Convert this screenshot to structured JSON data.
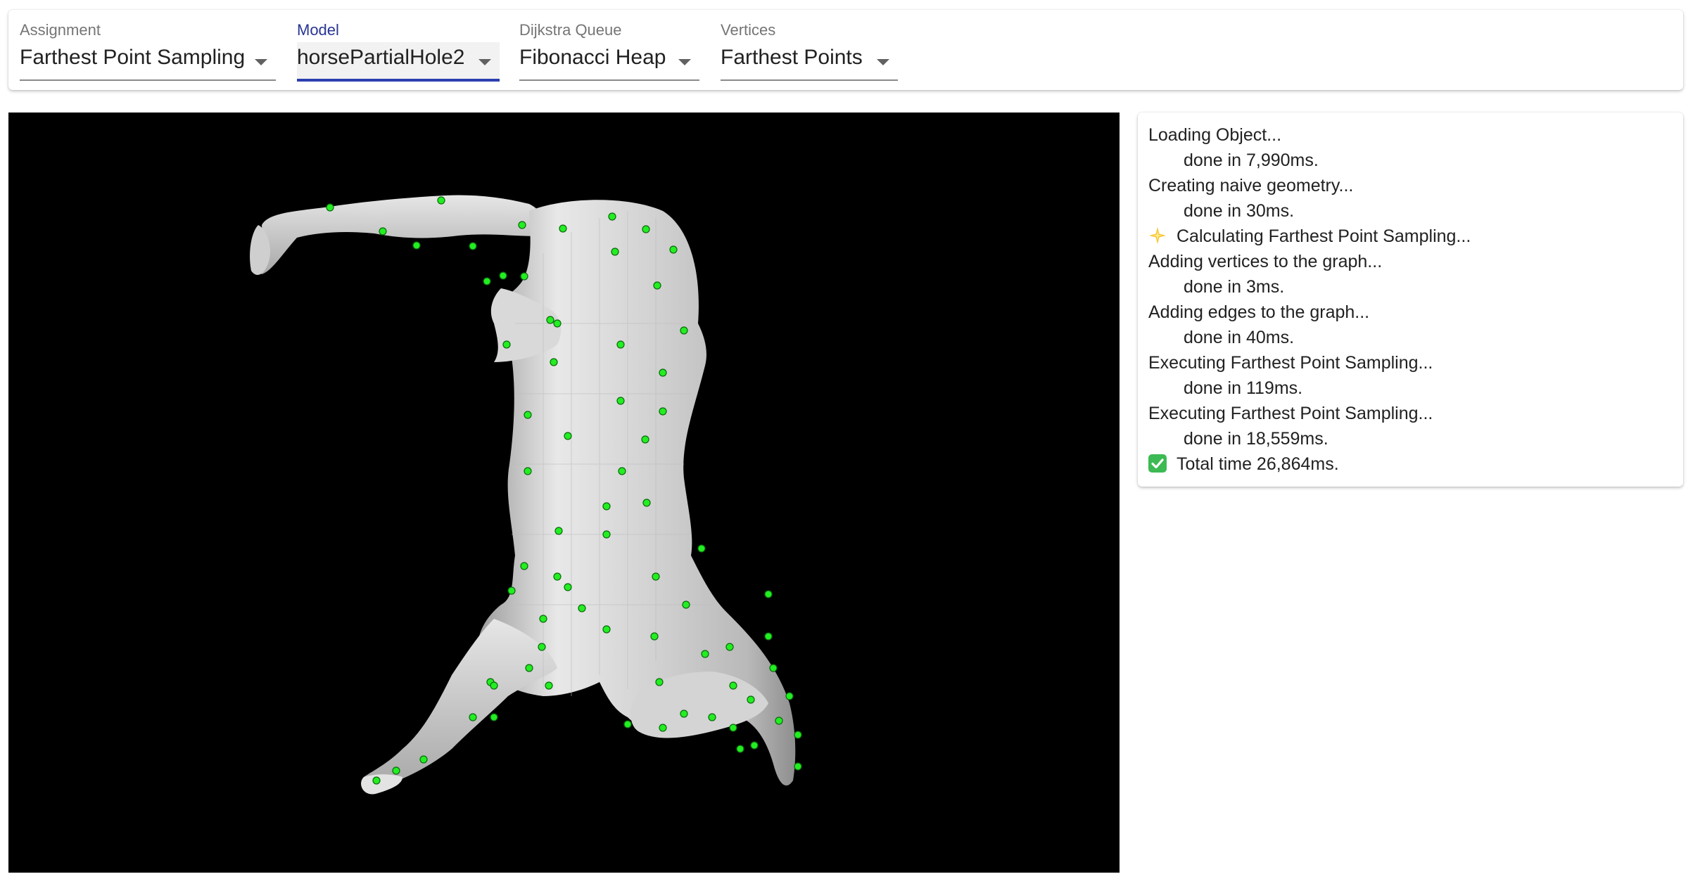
{
  "toolbar": {
    "selects": [
      {
        "label": "Assignment",
        "value": "Farthest Point Sampling",
        "focused": false
      },
      {
        "label": "Model",
        "value": "horsePartialHole2",
        "focused": true
      },
      {
        "label": "Dijkstra Queue",
        "value": "Fibonacci Heap",
        "focused": false
      },
      {
        "label": "Vertices",
        "value": "Farthest Points",
        "focused": false
      }
    ]
  },
  "viewport": {
    "background": "#000000",
    "mesh_color": "#d9d9d9",
    "point_color": "#22ee22"
  },
  "log": {
    "lines": [
      {
        "text": "Loading Object...",
        "indent": false,
        "icon": null
      },
      {
        "text": "done in 7,990ms.",
        "indent": true,
        "icon": null
      },
      {
        "text": "Creating naive geometry...",
        "indent": false,
        "icon": null
      },
      {
        "text": "done in 30ms.",
        "indent": true,
        "icon": null
      },
      {
        "text": "Calculating Farthest Point Sampling...",
        "indent": false,
        "icon": "sparkle-icon"
      },
      {
        "text": "Adding vertices to the graph...",
        "indent": false,
        "icon": null
      },
      {
        "text": "done in 3ms.",
        "indent": true,
        "icon": null
      },
      {
        "text": "Adding edges to the graph...",
        "indent": false,
        "icon": null
      },
      {
        "text": "done in 40ms.",
        "indent": true,
        "icon": null
      },
      {
        "text": "Executing Farthest Point Sampling...",
        "indent": false,
        "icon": null
      },
      {
        "text": "done in 119ms.",
        "indent": true,
        "icon": null
      },
      {
        "text": "Executing Farthest Point Sampling...",
        "indent": false,
        "icon": null
      },
      {
        "text": "done in 18,559ms.",
        "indent": true,
        "icon": null
      },
      {
        "text": "Total time 26,864ms.",
        "indent": false,
        "icon": "check-mark-icon"
      }
    ]
  }
}
